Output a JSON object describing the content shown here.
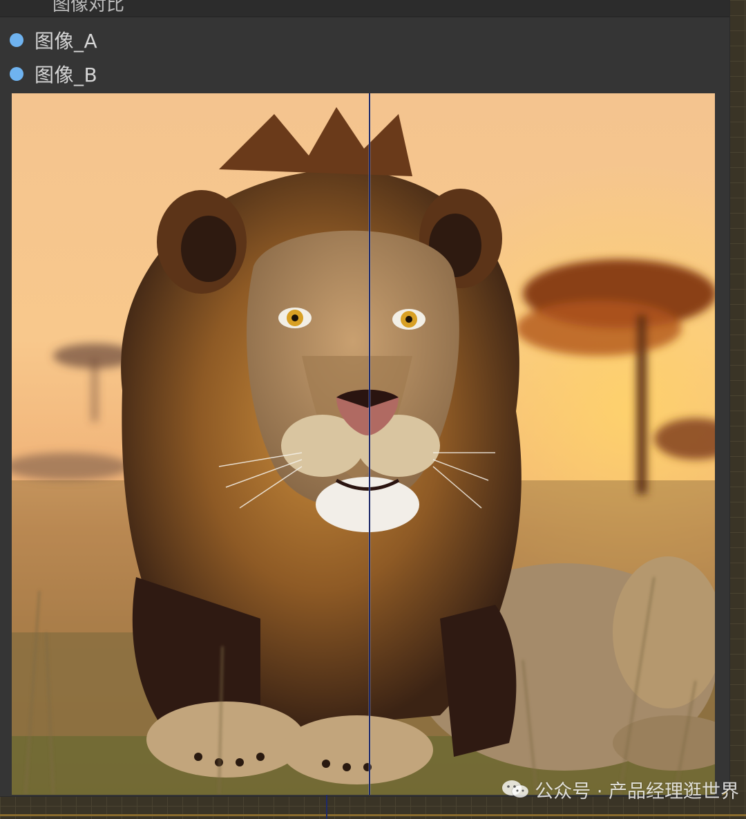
{
  "node": {
    "title": "图像对比",
    "inputs": [
      {
        "label": "图像_A"
      },
      {
        "label": "图像_B"
      }
    ]
  },
  "comparer": {
    "split_position": 0.508,
    "subject": "lion lying in savanna grass at sunset with acacia trees"
  },
  "watermark": {
    "text": "公众号 · 产品经理逛世界",
    "icon": "wechat-icon"
  },
  "colors": {
    "slot_dot": "#6fb3f0",
    "node_body": "#353535",
    "canvas": "#3a3426",
    "divider": "#1e2a6a"
  }
}
